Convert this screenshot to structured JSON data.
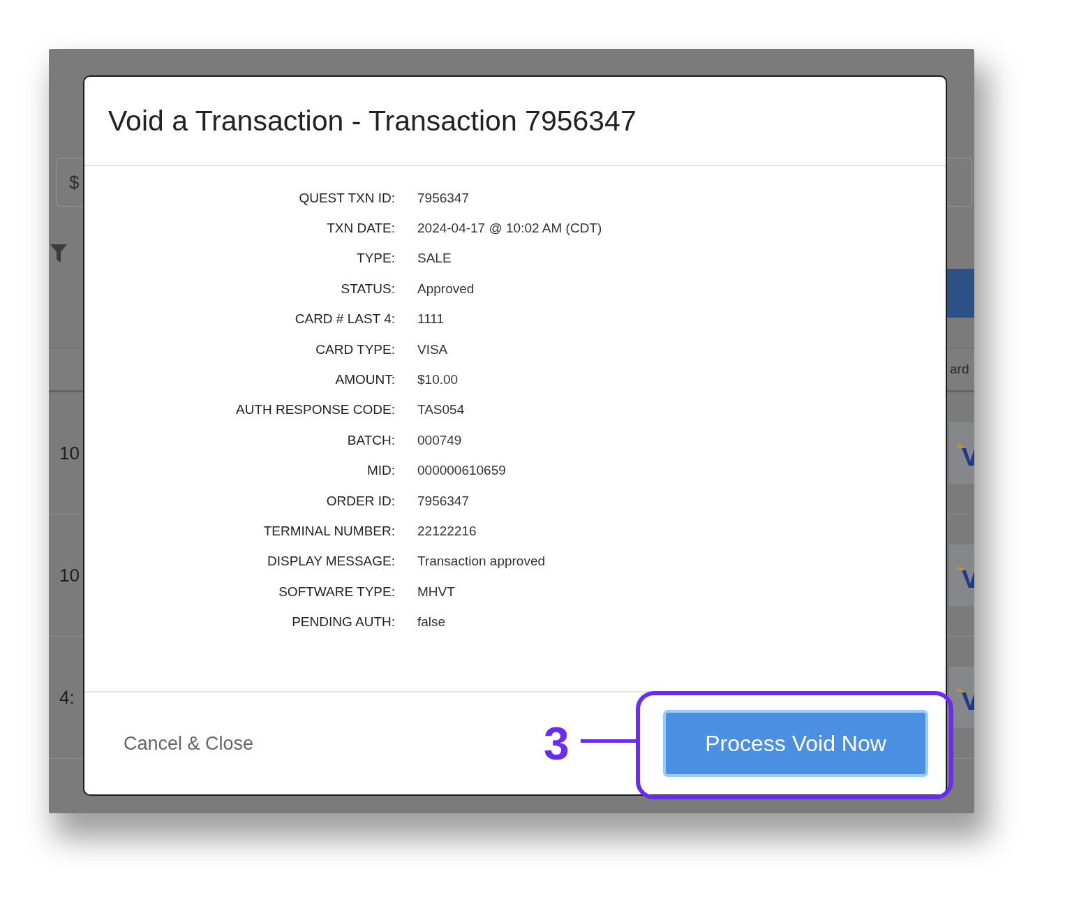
{
  "backdrop": {
    "search_prefix": "$",
    "column_heading": "ard",
    "rows": [
      {
        "cell_text": "10"
      },
      {
        "cell_text": "10"
      },
      {
        "cell_text": "4:"
      }
    ]
  },
  "dialog": {
    "title": "Void a Transaction - Transaction 7956347",
    "details": [
      {
        "label": "QUEST TXN ID:",
        "value": "7956347"
      },
      {
        "label": "TXN DATE:",
        "value": "2024-04-17 @ 10:02 AM (CDT)"
      },
      {
        "label": "TYPE:",
        "value": "SALE"
      },
      {
        "label": "STATUS:",
        "value": "Approved"
      },
      {
        "label": "CARD # LAST 4:",
        "value": "1111"
      },
      {
        "label": "CARD TYPE:",
        "value": "VISA"
      },
      {
        "label": "AMOUNT:",
        "value": "$10.00"
      },
      {
        "label": "AUTH RESPONSE CODE:",
        "value": "TAS054"
      },
      {
        "label": "BATCH:",
        "value": "000749"
      },
      {
        "label": "MID:",
        "value": "000000610659"
      },
      {
        "label": "ORDER ID:",
        "value": "7956347"
      },
      {
        "label": "TERMINAL NUMBER:",
        "value": "22122216"
      },
      {
        "label": "DISPLAY MESSAGE:",
        "value": "Transaction approved"
      },
      {
        "label": "SOFTWARE TYPE:",
        "value": "MHVT"
      },
      {
        "label": "PENDING AUTH:",
        "value": "false"
      }
    ],
    "cancel_link": "Cancel & Close",
    "primary_button": "Process Void Now"
  },
  "annotation": {
    "step_number": "3"
  }
}
